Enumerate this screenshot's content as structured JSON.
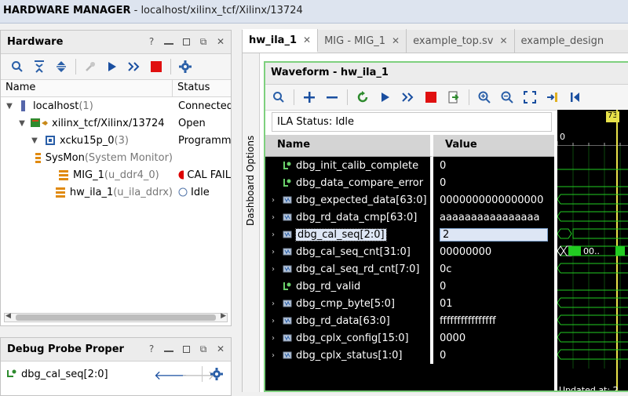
{
  "window": {
    "app_name": "HARDWARE MANAGER",
    "path": " - localhost/xilinx_tcf/Xilinx/13724"
  },
  "hardware": {
    "title": "Hardware",
    "help": "?",
    "col_name": "Name",
    "col_status": "Status",
    "rows": [
      {
        "name": "localhost",
        "extra": " (1)",
        "status": "Connected"
      },
      {
        "name": "xilinx_tcf/Xilinx/13724",
        "extra": "",
        "status": "Open"
      },
      {
        "name": "xcku15p_0",
        "extra": " (3)",
        "status": "Programmed"
      },
      {
        "name": "SysMon",
        "extra": " (System Monitor)",
        "status": ""
      },
      {
        "name": "MIG_1",
        "extra": " (u_ddr4_0)",
        "status": "CAL FAIL"
      },
      {
        "name": "hw_ila_1",
        "extra": " (u_ila_ddrx)",
        "status": "Idle"
      }
    ]
  },
  "probe": {
    "title": "Debug Probe Proper",
    "help": "?",
    "signal": "dbg_cal_seq[2:0]"
  },
  "tabs": [
    {
      "label": "hw_ila_1",
      "active": true
    },
    {
      "label": "MIG - MIG_1"
    },
    {
      "label": "example_top.sv"
    },
    {
      "label": "example_design"
    }
  ],
  "dashboard_label": "Dashboard Options",
  "waveform": {
    "title": "Waveform - hw_ila_1",
    "ila_status": "ILA Status:  Idle",
    "col_name": "Name",
    "col_value": "Value",
    "cursor": "73",
    "scale_zero": "0",
    "updated": "Updated at: 2",
    "bus_label": "00..",
    "signals": [
      {
        "name": "dbg_init_calib_complete",
        "value": "0",
        "bus": false
      },
      {
        "name": "dbg_data_compare_error",
        "value": "0",
        "bus": false
      },
      {
        "name": "dbg_expected_data[63:0]",
        "value": "0000000000000000",
        "bus": true
      },
      {
        "name": "dbg_rd_data_cmp[63:0]",
        "value": "aaaaaaaaaaaaaaaa",
        "bus": true
      },
      {
        "name": "dbg_cal_seq[2:0]",
        "value": "2",
        "bus": true,
        "selected": true
      },
      {
        "name": "dbg_cal_seq_cnt[31:0]",
        "value": "00000000",
        "bus": true
      },
      {
        "name": "dbg_cal_seq_rd_cnt[7:0]",
        "value": "0c",
        "bus": true
      },
      {
        "name": "dbg_rd_valid",
        "value": "0",
        "bus": false
      },
      {
        "name": "dbg_cmp_byte[5:0]",
        "value": "01",
        "bus": true
      },
      {
        "name": "dbg_rd_data[63:0]",
        "value": "ffffffffffffffff",
        "bus": true
      },
      {
        "name": "dbg_cplx_config[15:0]",
        "value": "0000",
        "bus": true
      },
      {
        "name": "dbg_cplx_status[1:0]",
        "value": "0",
        "bus": true
      }
    ]
  },
  "colors": {
    "accent": "#1560bd",
    "run": "#1a4fa0",
    "stop": "#e01010",
    "wave_green": "#22cc22",
    "cal_fail": "#dd0000"
  }
}
